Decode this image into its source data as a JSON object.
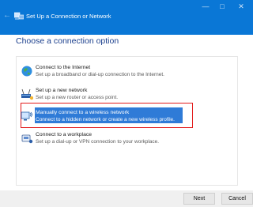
{
  "window": {
    "title": "Set Up a Connection or Network",
    "back_icon": "back-arrow-icon",
    "controls": {
      "minimize": "—",
      "maximize": "□",
      "close": "✕"
    }
  },
  "heading": "Choose a connection option",
  "options": [
    {
      "icon": "globe-network-icon",
      "label": "Connect to the Internet",
      "desc": "Set up a broadband or dial-up connection to the Internet."
    },
    {
      "icon": "router-icon",
      "label": "Set up a new network",
      "desc": "Set up a new router or access point."
    },
    {
      "icon": "wireless-computer-icon",
      "label": "Manually connect to a wireless network",
      "desc": "Connect to a hidden network or create a new wireless profile.",
      "selected": true
    },
    {
      "icon": "workplace-phone-icon",
      "label": "Connect to a workplace",
      "desc": "Set up a dial-up or VPN connection to your workplace."
    }
  ],
  "buttons": {
    "next": "Next",
    "cancel": "Cancel"
  },
  "colors": {
    "titlebar": "#0a77d6",
    "heading": "#1a3e8c",
    "selection": "#2f7bd7",
    "highlight_border": "#e21b1b"
  }
}
